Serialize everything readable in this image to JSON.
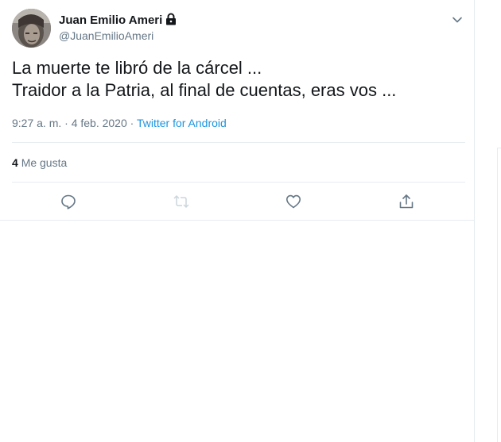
{
  "tweet": {
    "author": {
      "name": "Juan Emilio Ameri",
      "handle": "@JuanEmilioAmeri",
      "protected": true
    },
    "text_lines": [
      "La muerte te libró de la cárcel ...",
      "Traidor a la Patria, al final de cuentas, eras vos ..."
    ],
    "timestamp": "9:27 a. m. · 4 feb. 2020",
    "separator": " · ",
    "source": "Twitter for Android",
    "likes_count": "4",
    "likes_label": "Me gusta"
  },
  "actions": [
    {
      "name": "reply",
      "icon": "reply-icon"
    },
    {
      "name": "retweet",
      "icon": "retweet-icon",
      "disabled": true
    },
    {
      "name": "like",
      "icon": "heart-icon"
    },
    {
      "name": "share",
      "icon": "share-icon"
    }
  ],
  "colors": {
    "text_primary": "#14171a",
    "text_secondary": "#657786",
    "link": "#1b95e0",
    "divider": "#e6ecf0",
    "icon": "#657786",
    "icon_disabled": "#ccd6dd"
  }
}
